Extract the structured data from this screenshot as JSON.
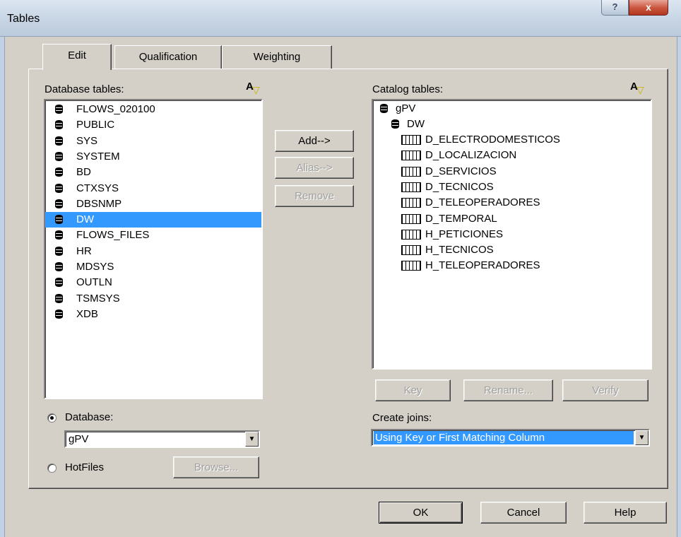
{
  "window": {
    "title": "Tables",
    "help_glyph": "?",
    "close_glyph": "x"
  },
  "tabs": [
    {
      "label": "Edit",
      "active": true
    },
    {
      "label": "Qualification",
      "active": false
    },
    {
      "label": "Weighting",
      "active": false
    }
  ],
  "database_tables": {
    "label": "Database tables:",
    "filter_icon": "filter-icon",
    "items": [
      "FLOWS_020100",
      "PUBLIC",
      "SYS",
      "SYSTEM",
      "BD",
      "CTXSYS",
      "DBSNMP",
      "DW",
      "FLOWS_FILES",
      "HR",
      "MDSYS",
      "OUTLN",
      "TSMSYS",
      "XDB"
    ],
    "selected": "DW"
  },
  "middle_buttons": {
    "add": "Add-->",
    "alias": "Alias-->",
    "remove": "Remove"
  },
  "catalog_tables": {
    "label": "Catalog tables:",
    "filter_icon": "filter-icon",
    "root": "gPV",
    "schema": "DW",
    "tables": [
      "D_ELECTRODOMESTICOS",
      "D_LOCALIZACION",
      "D_SERVICIOS",
      "D_TECNICOS",
      "D_TELEOPERADORES",
      "D_TEMPORAL",
      "H_PETICIONES",
      "H_TECNICOS",
      "H_TELEOPERADORES"
    ]
  },
  "catalog_buttons": {
    "key": "Key",
    "rename": "Rename...",
    "verify": "Verify"
  },
  "source": {
    "database_label": "Database:",
    "database_value": "gPV",
    "hotfiles_label": "HotFiles",
    "browse_label": "Browse...",
    "selected": "Database"
  },
  "joins": {
    "label": "Create joins:",
    "value": "Using Key or First Matching Column"
  },
  "footer": {
    "ok": "OK",
    "cancel": "Cancel",
    "help": "Help"
  },
  "colors": {
    "selection": "#3399ff",
    "face": "#d4d0c8"
  }
}
